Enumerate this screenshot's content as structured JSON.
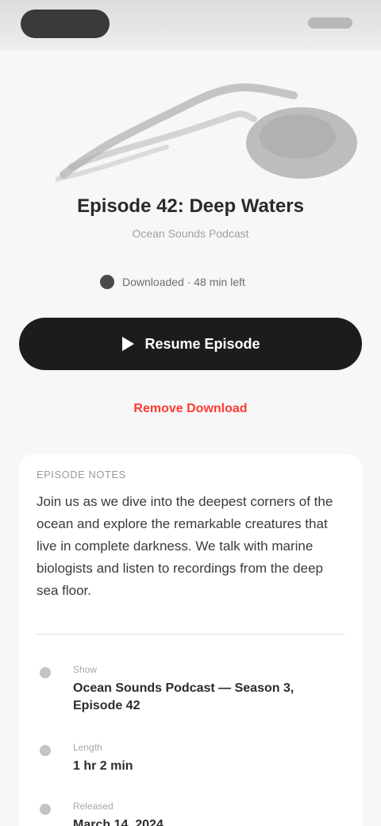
{
  "episode": {
    "title": "Episode 42: Deep Waters",
    "subtitle": "Ocean Sounds Podcast",
    "meta": "Downloaded · 48 min left"
  },
  "actions": {
    "play_label": "Resume Episode",
    "remove_label": "Remove Download"
  },
  "details": {
    "header": "EPISODE NOTES",
    "description": "Join us as we dive into the deepest corners of the ocean and explore the remarkable creatures that live in complete darkness. We talk with marine biologists and listen to recordings from the deep sea floor.",
    "rows": [
      {
        "label": "Show",
        "value": "Ocean Sounds Podcast — Season 3, Episode 42"
      },
      {
        "label": "Length",
        "value": "1 hr 2 min"
      },
      {
        "label": "Released",
        "value": "March 14, 2024"
      }
    ]
  },
  "colors": {
    "accent": "#1c1c1e",
    "danger": "#ff3b30",
    "background": "#f7f7f8"
  }
}
